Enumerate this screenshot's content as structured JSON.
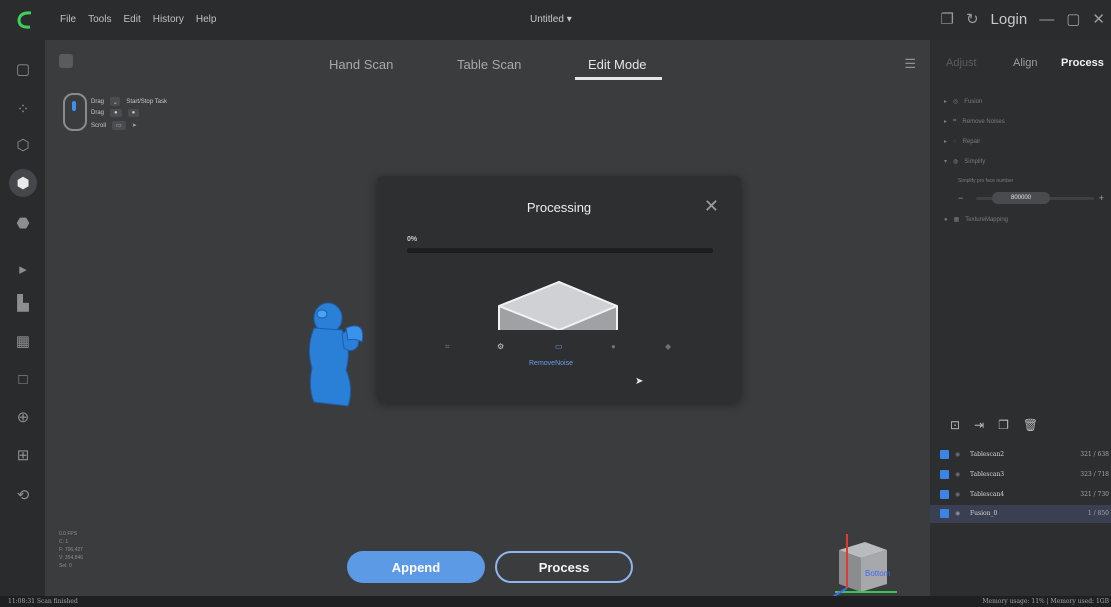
{
  "app": {
    "title": "Untitled"
  },
  "menu": [
    "File",
    "Tools",
    "Edit",
    "History",
    "Help"
  ],
  "window": {
    "login": "Login"
  },
  "tabs": [
    {
      "label": "Hand Scan",
      "active": false
    },
    {
      "label": "Table Scan",
      "active": false
    },
    {
      "label": "Edit Mode",
      "active": true
    }
  ],
  "mouse_help": [
    {
      "action": "Drag",
      "desc": "Start/Stop Task"
    },
    {
      "action": "Drag",
      "desc": ""
    },
    {
      "action": "Scroll",
      "desc": ""
    }
  ],
  "viewport": {
    "stats": [
      "0.0 FPS",
      "C: 1",
      "F: 706,427",
      "V: 354,846",
      "Sel: 0"
    ],
    "append_label": "Append",
    "process_label": "Process",
    "cube_face_label": "Bottom"
  },
  "dialog": {
    "title": "Processing",
    "progress_text": "0%",
    "progress": 0,
    "active_step": "RemoveNoise"
  },
  "right_panel": {
    "tabs": [
      {
        "label": "Adjust",
        "state": "dim"
      },
      {
        "label": "Align",
        "state": "normal"
      },
      {
        "label": "Process",
        "state": "active"
      }
    ],
    "options": [
      "Fusion",
      "Remove Noises",
      "Repair",
      "Simplify"
    ],
    "simplify_label": "Simplify pro face number",
    "simplify_value": "800000",
    "texture_label": "TextureMapping",
    "scans": [
      {
        "name": "Tablescan2",
        "stats": "321 / 638",
        "selected": false
      },
      {
        "name": "Tablescan3",
        "stats": "323 / 718",
        "selected": false
      },
      {
        "name": "Tablescan4",
        "stats": "321 / 730",
        "selected": false
      },
      {
        "name": "Fusion_0",
        "stats": "1 / 850",
        "selected": true
      }
    ]
  },
  "statusbar": {
    "left": "11:08:31 Scan finished",
    "right": "Memory usage: 11% | Memory used: 1GB"
  },
  "colors": {
    "accent": "#5d9ae6",
    "checkbox": "#3b84e6",
    "model": "#2a7fd6"
  }
}
